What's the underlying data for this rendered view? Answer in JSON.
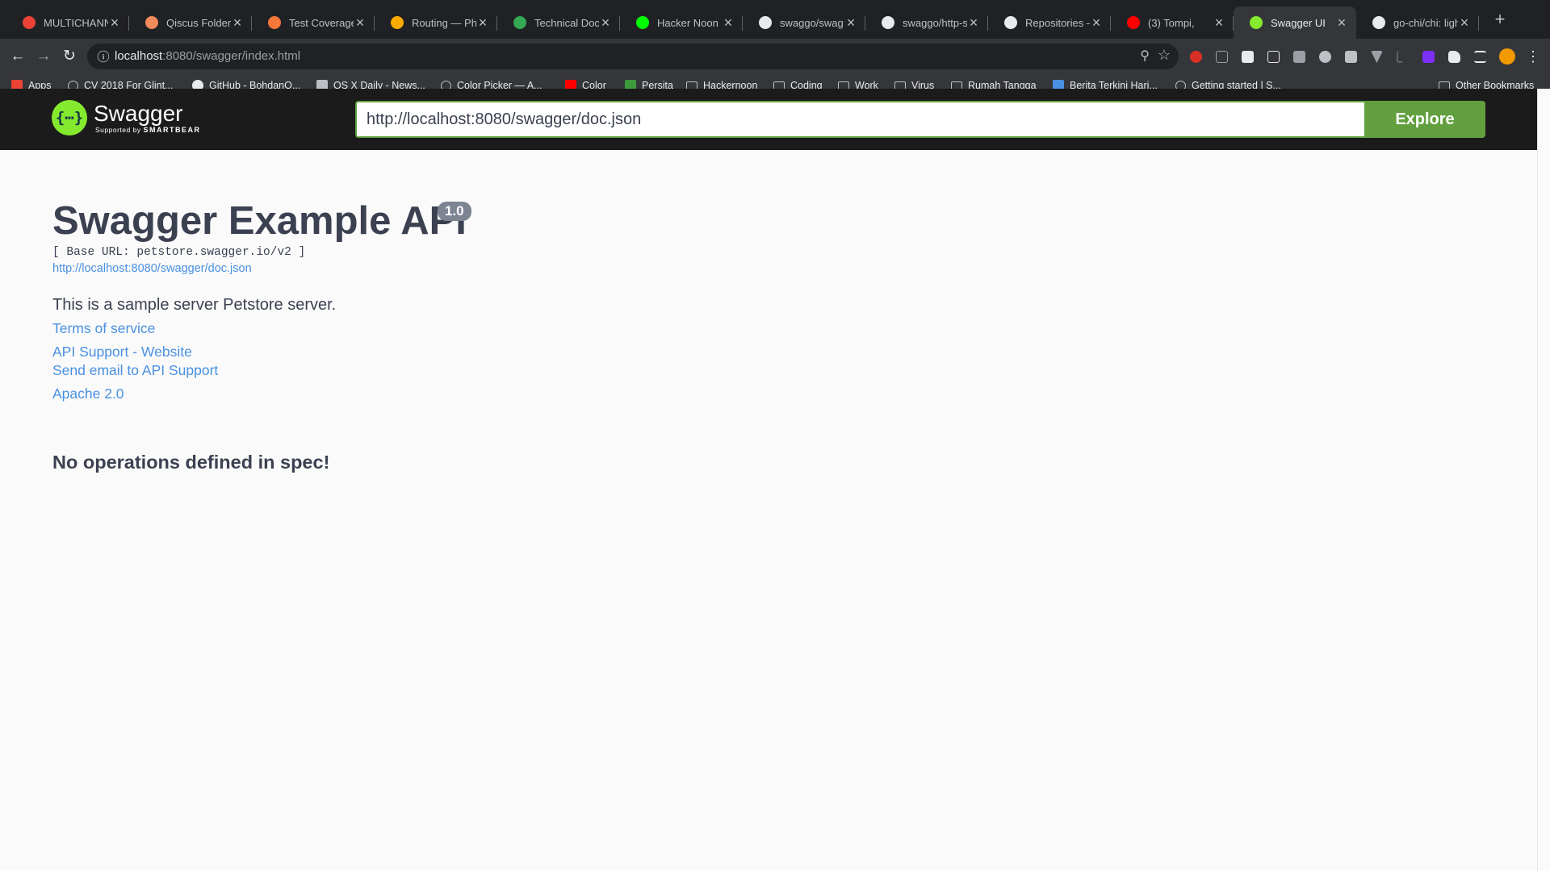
{
  "browser": {
    "tabs": [
      {
        "title": "MULTICHANNEL",
        "favicon_color": "#ea4335",
        "active": false
      },
      {
        "title": "Qiscus Folder -",
        "favicon_color": "#f28b5b",
        "active": false
      },
      {
        "title": "Test Coverage",
        "favicon_color": "#f5773a",
        "active": false
      },
      {
        "title": "Routing — Phoe",
        "favicon_color": "#f9ab00",
        "active": false
      },
      {
        "title": "Technical Docu",
        "favicon_color": "#34a853",
        "active": false
      },
      {
        "title": "Hacker Noon 2",
        "favicon_color": "#00fe00",
        "active": false
      },
      {
        "title": "swaggo/swag:",
        "favicon_color": "#e8eaed",
        "active": false
      },
      {
        "title": "swaggo/http-sw",
        "favicon_color": "#e8eaed",
        "active": false
      },
      {
        "title": "Repositories —",
        "favicon_color": "#e8eaed",
        "active": false
      },
      {
        "title": "(3) Tompi,",
        "favicon_color": "#ff0000",
        "active": false
      },
      {
        "title": "Swagger UI",
        "favicon_color": "#85ea2d",
        "active": true
      },
      {
        "title": "go-chi/chi: ligh",
        "favicon_color": "#e8eaed",
        "active": false
      }
    ],
    "new_tab_label": "+",
    "address": {
      "host": "localhost",
      "rest": ":8080/swagger/index.html"
    },
    "bookmarks": [
      {
        "label": "Apps",
        "icon": "apps-grid-icon",
        "color": "#ea4335"
      },
      {
        "label": "CV 2018 For Glint...",
        "icon": "globe-icon",
        "color": "#bdc1c6"
      },
      {
        "label": "GitHub - BohdanO...",
        "icon": "github-icon",
        "color": "#e8eaed"
      },
      {
        "label": "OS X Daily - News...",
        "icon": "osx-daily-icon",
        "color": "#bdc1c6"
      },
      {
        "label": "Color Picker — A...",
        "icon": "globe-icon",
        "color": "#bdc1c6"
      },
      {
        "label": "Color",
        "icon": "adobe-icon",
        "color": "#ff0000"
      },
      {
        "label": "Persita",
        "icon": "persita-icon",
        "color": "#3c9a3c"
      },
      {
        "label": "Hackernoon",
        "icon": "folder-icon",
        "color": "#bdc1c6"
      },
      {
        "label": "Coding",
        "icon": "folder-icon",
        "color": "#bdc1c6"
      },
      {
        "label": "Work",
        "icon": "folder-icon",
        "color": "#bdc1c6"
      },
      {
        "label": "Virus",
        "icon": "folder-icon",
        "color": "#bdc1c6"
      },
      {
        "label": "Rumah Tangga",
        "icon": "folder-icon",
        "color": "#bdc1c6"
      },
      {
        "label": "Berita Terkini Hari...",
        "icon": "news-icon",
        "color": "#4a90e2"
      },
      {
        "label": "Getting started | S...",
        "icon": "globe-icon",
        "color": "#bdc1c6"
      }
    ],
    "other_bookmarks": "Other Bookmarks"
  },
  "swagger": {
    "logo_name": "Swagger",
    "logo_supported": "Supported by",
    "logo_brand": "SMARTBEAR",
    "spec_url": "http://localhost:8080/swagger/doc.json",
    "explore_label": "Explore",
    "accent_color": "#62a03f"
  },
  "info": {
    "title": "Swagger Example API",
    "version": "1.0",
    "base_url": "[ Base URL: petstore.swagger.io/v2 ]",
    "spec_link": "http://localhost:8080/swagger/doc.json",
    "description": "This is a sample server Petstore server.",
    "terms": "Terms of service",
    "support_website": "API Support - Website",
    "support_email": "Send email to API Support",
    "license": "Apache 2.0"
  },
  "operations_message": "No operations defined in spec!"
}
